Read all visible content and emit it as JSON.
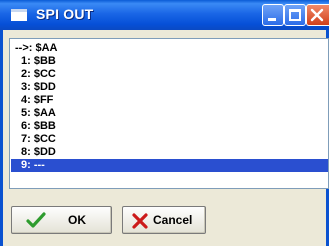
{
  "window": {
    "title": "SPI OUT"
  },
  "titlebar_buttons": [
    {
      "name": "minimize",
      "icon": "minimize-icon"
    },
    {
      "name": "maximize",
      "icon": "maximize-icon"
    },
    {
      "name": "close",
      "icon": "close-icon"
    }
  ],
  "list": {
    "items": [
      "-->: $AA",
      "1: $BB",
      "2: $CC",
      "3: $DD",
      "4: $FF",
      "5: $AA",
      "6: $BB",
      "7: $CC",
      "8: $DD",
      "9: ---"
    ],
    "selected_index": 9
  },
  "buttons": {
    "ok_label": "OK",
    "ok_icon": "checkmark-icon",
    "cancel_label": "Cancel",
    "cancel_icon": "red-x-icon"
  },
  "colors": {
    "titlebar": "#0a5bd6",
    "selection": "#2a4fd0",
    "checkmark": "#2e9c2e",
    "cancel_x": "#cc1a1a"
  }
}
